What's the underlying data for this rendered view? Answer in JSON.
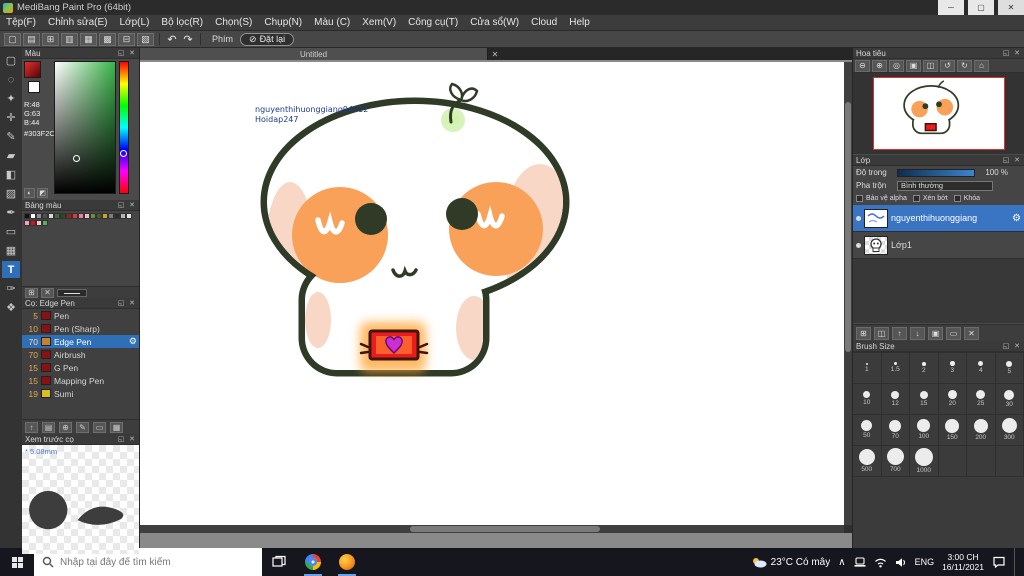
{
  "window": {
    "title": "MediBang Paint Pro (64bit)",
    "minimize": "─",
    "maximize": "▢",
    "close": "✕"
  },
  "menubar": {
    "items": [
      "Tệp(F)",
      "Chỉnh sửa(E)",
      "Lớp(L)",
      "Bộ lọc(R)",
      "Chọn(S)",
      "Chụp(N)",
      "Màu (C)",
      "Xem(V)",
      "Công cụ(T)",
      "Cửa sổ(W)",
      "Cloud",
      "Help"
    ]
  },
  "toolbar": {
    "phim_label": "Phím",
    "reset_label": "Đặt lại",
    "icons": [
      {
        "name": "new-file-icon",
        "glyph": "▢"
      },
      {
        "name": "open-file-icon",
        "glyph": "▤"
      },
      {
        "name": "save-icon",
        "glyph": "⊞"
      },
      {
        "name": "export-icon",
        "glyph": "▥"
      },
      {
        "name": "grid-toggle-icon",
        "glyph": "▦"
      },
      {
        "name": "snap-toggle-icon",
        "glyph": "▩"
      },
      {
        "name": "ruler-icon",
        "glyph": "⊟"
      },
      {
        "name": "material-icon",
        "glyph": "▧"
      }
    ]
  },
  "tools": [
    {
      "name": "select-rect-tool",
      "glyph": "▢",
      "active": false
    },
    {
      "name": "lasso-tool",
      "glyph": "◌",
      "active": false
    },
    {
      "name": "magic-wand-tool",
      "glyph": "✦",
      "active": false
    },
    {
      "name": "move-tool",
      "glyph": "✛",
      "active": false
    },
    {
      "name": "brush-tool",
      "glyph": "✎",
      "active": false
    },
    {
      "name": "eraser-tool",
      "glyph": "▰",
      "active": false
    },
    {
      "name": "fill-tool",
      "glyph": "◧",
      "active": false
    },
    {
      "name": "gradient-tool",
      "glyph": "▨",
      "active": false
    },
    {
      "name": "pen-tool",
      "glyph": "✒",
      "active": false
    },
    {
      "name": "shape-tool",
      "glyph": "▭",
      "active": false
    },
    {
      "name": "divide-tool",
      "glyph": "▦",
      "active": false
    },
    {
      "name": "text-tool",
      "glyph": "T",
      "active": true
    },
    {
      "name": "eyedropper-tool",
      "glyph": "✑",
      "active": false
    },
    {
      "name": "hand-tool",
      "glyph": "❖",
      "active": false
    }
  ],
  "document": {
    "tab_title": "Untitled",
    "watermark_line1": "nguyenthihuonggiang94512",
    "watermark_line2": "Hoidap247"
  },
  "color_panel": {
    "title": "Màu",
    "r": "R:48",
    "g": "G:63",
    "b": "B:44",
    "hex": "#303F2C"
  },
  "palette_panel": {
    "title": "Bảng màu",
    "row1": [
      "#111111",
      "#ffffff",
      "#8e8e8e",
      "#4f4f4f",
      "#d9d9d9",
      "#3e6b35",
      "#27492a",
      "#9c1f1f",
      "#c94040",
      "#e87ea0",
      "#f3b8cc",
      "#6a8f3c",
      "#445c2e",
      "#c9a227",
      "#7d7d7d",
      "#2c2c2c",
      "#b5b5b5",
      "#e3e3e3"
    ],
    "row2": [
      "#f2a0b8",
      "#d01818",
      "#f6c3d0",
      "#58b05c"
    ]
  },
  "brush_panel": {
    "title": "Cọ: Edge Pen",
    "brushes": [
      {
        "size": "5",
        "name": "Pen",
        "color": "#8a1111",
        "selected": false
      },
      {
        "size": "10",
        "name": "Pen (Sharp)",
        "color": "#8a1111",
        "selected": false
      },
      {
        "size": "70",
        "name": "Edge Pen",
        "color": "#c87f2f",
        "selected": true
      },
      {
        "size": "70",
        "name": "Airbrush",
        "color": "#8a1111",
        "selected": false
      },
      {
        "size": "15",
        "name": "G Pen",
        "color": "#8a1111",
        "selected": false
      },
      {
        "size": "15",
        "name": "Mapping Pen",
        "color": "#8a1111",
        "selected": false
      },
      {
        "size": "19",
        "name": "Sumi",
        "color": "#d8c020",
        "selected": false
      }
    ],
    "footer_icons": [
      {
        "name": "brush-up-icon",
        "glyph": "↑"
      },
      {
        "name": "brush-duplicate-icon",
        "glyph": "▤"
      },
      {
        "name": "add-brush-icon",
        "glyph": "⊕"
      },
      {
        "name": "edit-brush-icon",
        "glyph": "✎"
      },
      {
        "name": "brush-folder-icon",
        "glyph": "▭"
      },
      {
        "name": "brush-menu-icon",
        "glyph": "▦"
      }
    ]
  },
  "preview_panel": {
    "title": "Xem trước cọ",
    "size_label": "* 5.08mm"
  },
  "navigator_panel": {
    "title": "Hoa tiêu",
    "icons": [
      {
        "name": "zoom-out-icon",
        "glyph": "⊖"
      },
      {
        "name": "zoom-in-icon",
        "glyph": "⊕"
      },
      {
        "name": "zoom-100-icon",
        "glyph": "◎"
      },
      {
        "name": "fit-screen-icon",
        "glyph": "▣"
      },
      {
        "name": "flip-view-icon",
        "glyph": "◫"
      },
      {
        "name": "rotate-left-icon",
        "glyph": "↺"
      },
      {
        "name": "rotate-right-icon",
        "glyph": "↻"
      },
      {
        "name": "reset-view-icon",
        "glyph": "⌂"
      }
    ]
  },
  "layer_panel": {
    "title": "Lớp",
    "opacity_label": "Độ trong",
    "opacity_value": "100 %",
    "blend_label": "Pha trộn",
    "blend_value": "Bình thường",
    "alpha_label": "Bảo vệ alpha",
    "clip_label": "Xén bớt",
    "lock_label": "Khóa",
    "layers": [
      {
        "name": "nguyenthihuonggiang",
        "selected": true
      },
      {
        "name": "Lớp1",
        "selected": false
      }
    ],
    "footer_icons": [
      {
        "name": "add-layer-icon",
        "glyph": "⊞"
      },
      {
        "name": "duplicate-layer-icon",
        "glyph": "◫"
      },
      {
        "name": "layer-up-icon",
        "glyph": "↑"
      },
      {
        "name": "layer-down-icon",
        "glyph": "↓"
      },
      {
        "name": "merge-layer-icon",
        "glyph": "▣"
      },
      {
        "name": "clear-layer-icon",
        "glyph": "▭"
      },
      {
        "name": "delete-layer-icon",
        "glyph": "✕"
      }
    ]
  },
  "brush_size_panel": {
    "title": "Brush Size",
    "sizes": [
      "1",
      "1.5",
      "2",
      "3",
      "4",
      "5",
      "10",
      "12",
      "15",
      "20",
      "25",
      "30",
      "50",
      "70",
      "100",
      "150",
      "200",
      "300",
      "500",
      "700",
      "1000"
    ]
  },
  "taskbar": {
    "search_placeholder": "Nhập tại đây để tìm kiếm",
    "weather": "23°C Có mây",
    "language": "ENG",
    "time": "3:00 CH",
    "date": "16/11/2021"
  },
  "icons": {
    "undo": "↶",
    "redo": "↷",
    "reset_circle": "⊘",
    "gear": "⚙",
    "popout": "◱",
    "close": "✕",
    "chevron_up": "∧",
    "add": "⊞",
    "delete": "✕"
  },
  "colors": {
    "accent_blue": "#2f6fb8",
    "selected_layer_blue": "#3a75c4",
    "outline_green": "#2f3b27",
    "cheek_orange": "#f9a159",
    "current_color_hex": "#303F2C"
  }
}
